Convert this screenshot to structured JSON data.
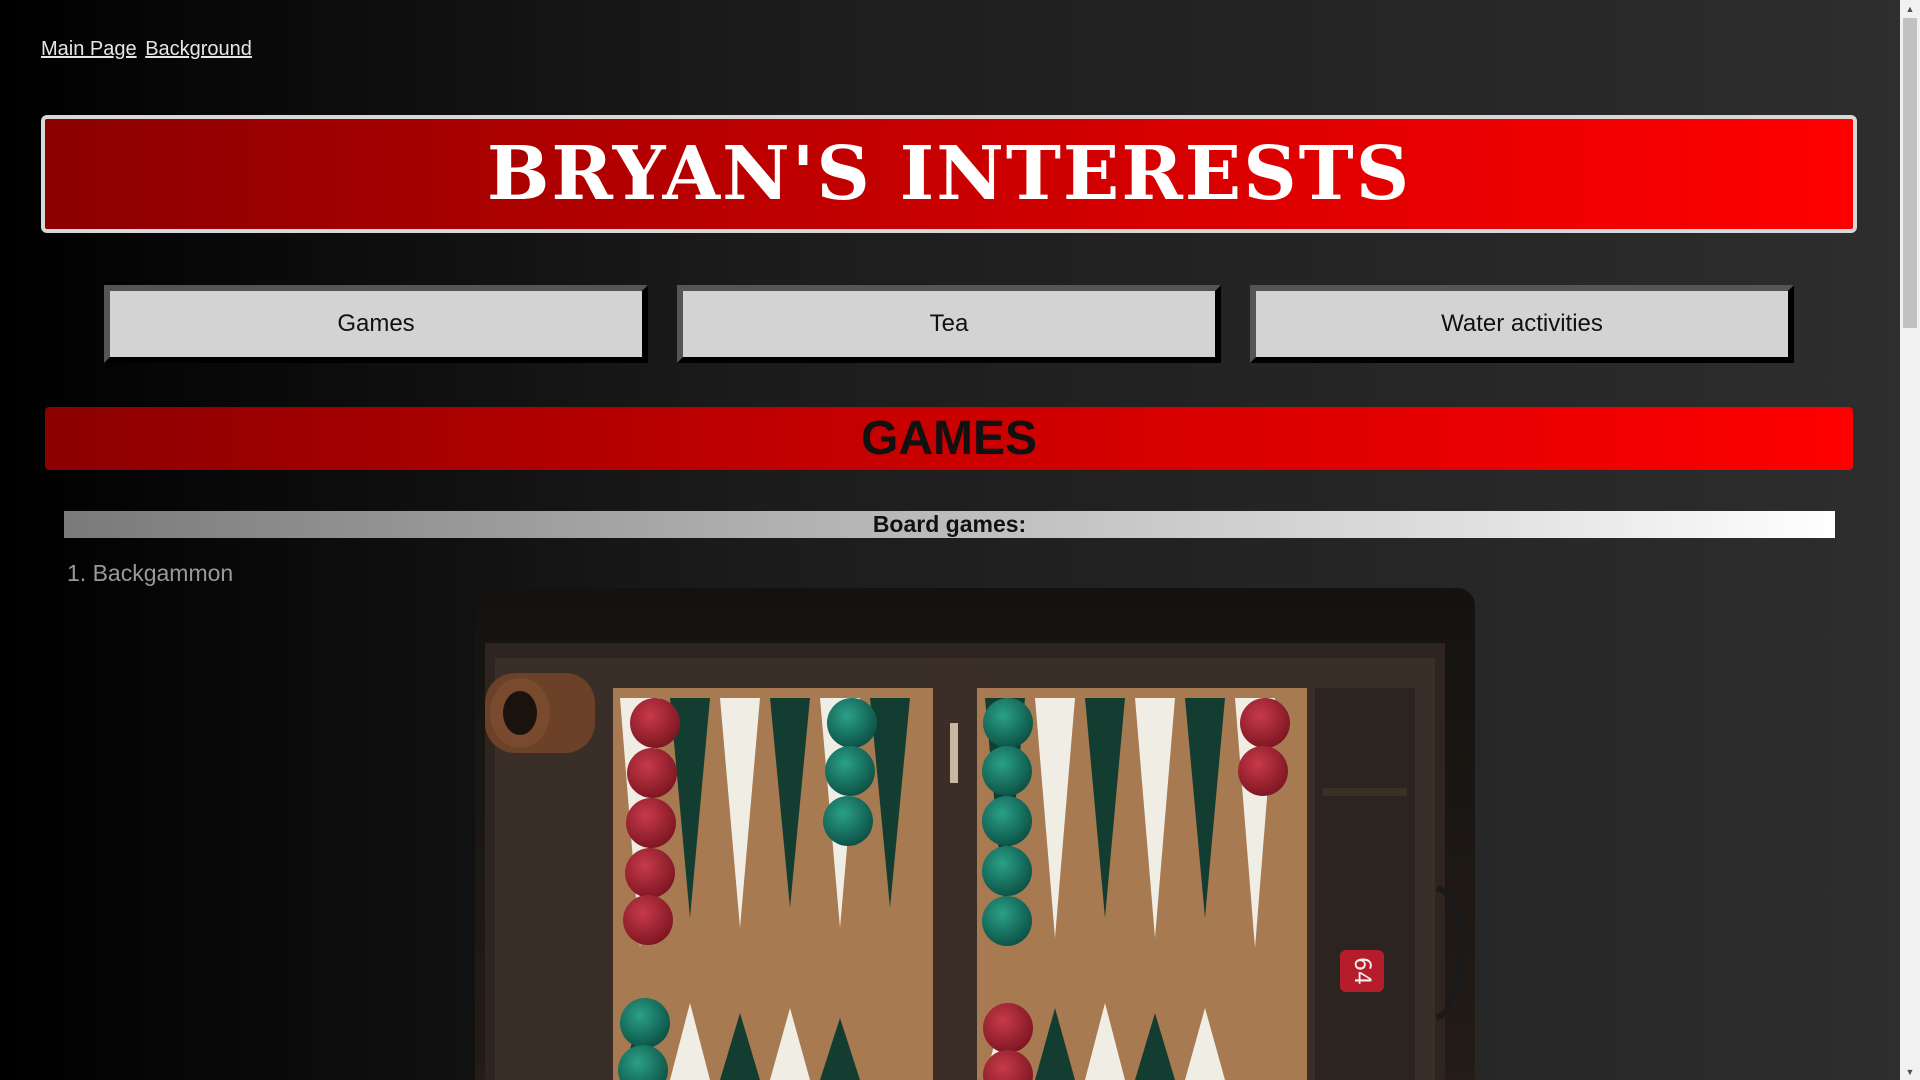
{
  "top_links": {
    "main_page": "Main Page",
    "background": "Background"
  },
  "banner": {
    "title": "BRYAN'S INTERESTS"
  },
  "nav": {
    "items": [
      {
        "label": "Games"
      },
      {
        "label": "Tea"
      },
      {
        "label": "Water activities"
      }
    ]
  },
  "section": {
    "title": "GAMES",
    "subheading": "Board games:",
    "list": [
      {
        "number": "1.",
        "label": "Backgammon"
      }
    ]
  },
  "photo": {
    "dice_text": "64",
    "icon": "backgammon-board-image"
  },
  "colors": {
    "banner_red": "#e00000",
    "nav_gray": "#d3d3d3",
    "list_text": "#9a9a9a"
  }
}
